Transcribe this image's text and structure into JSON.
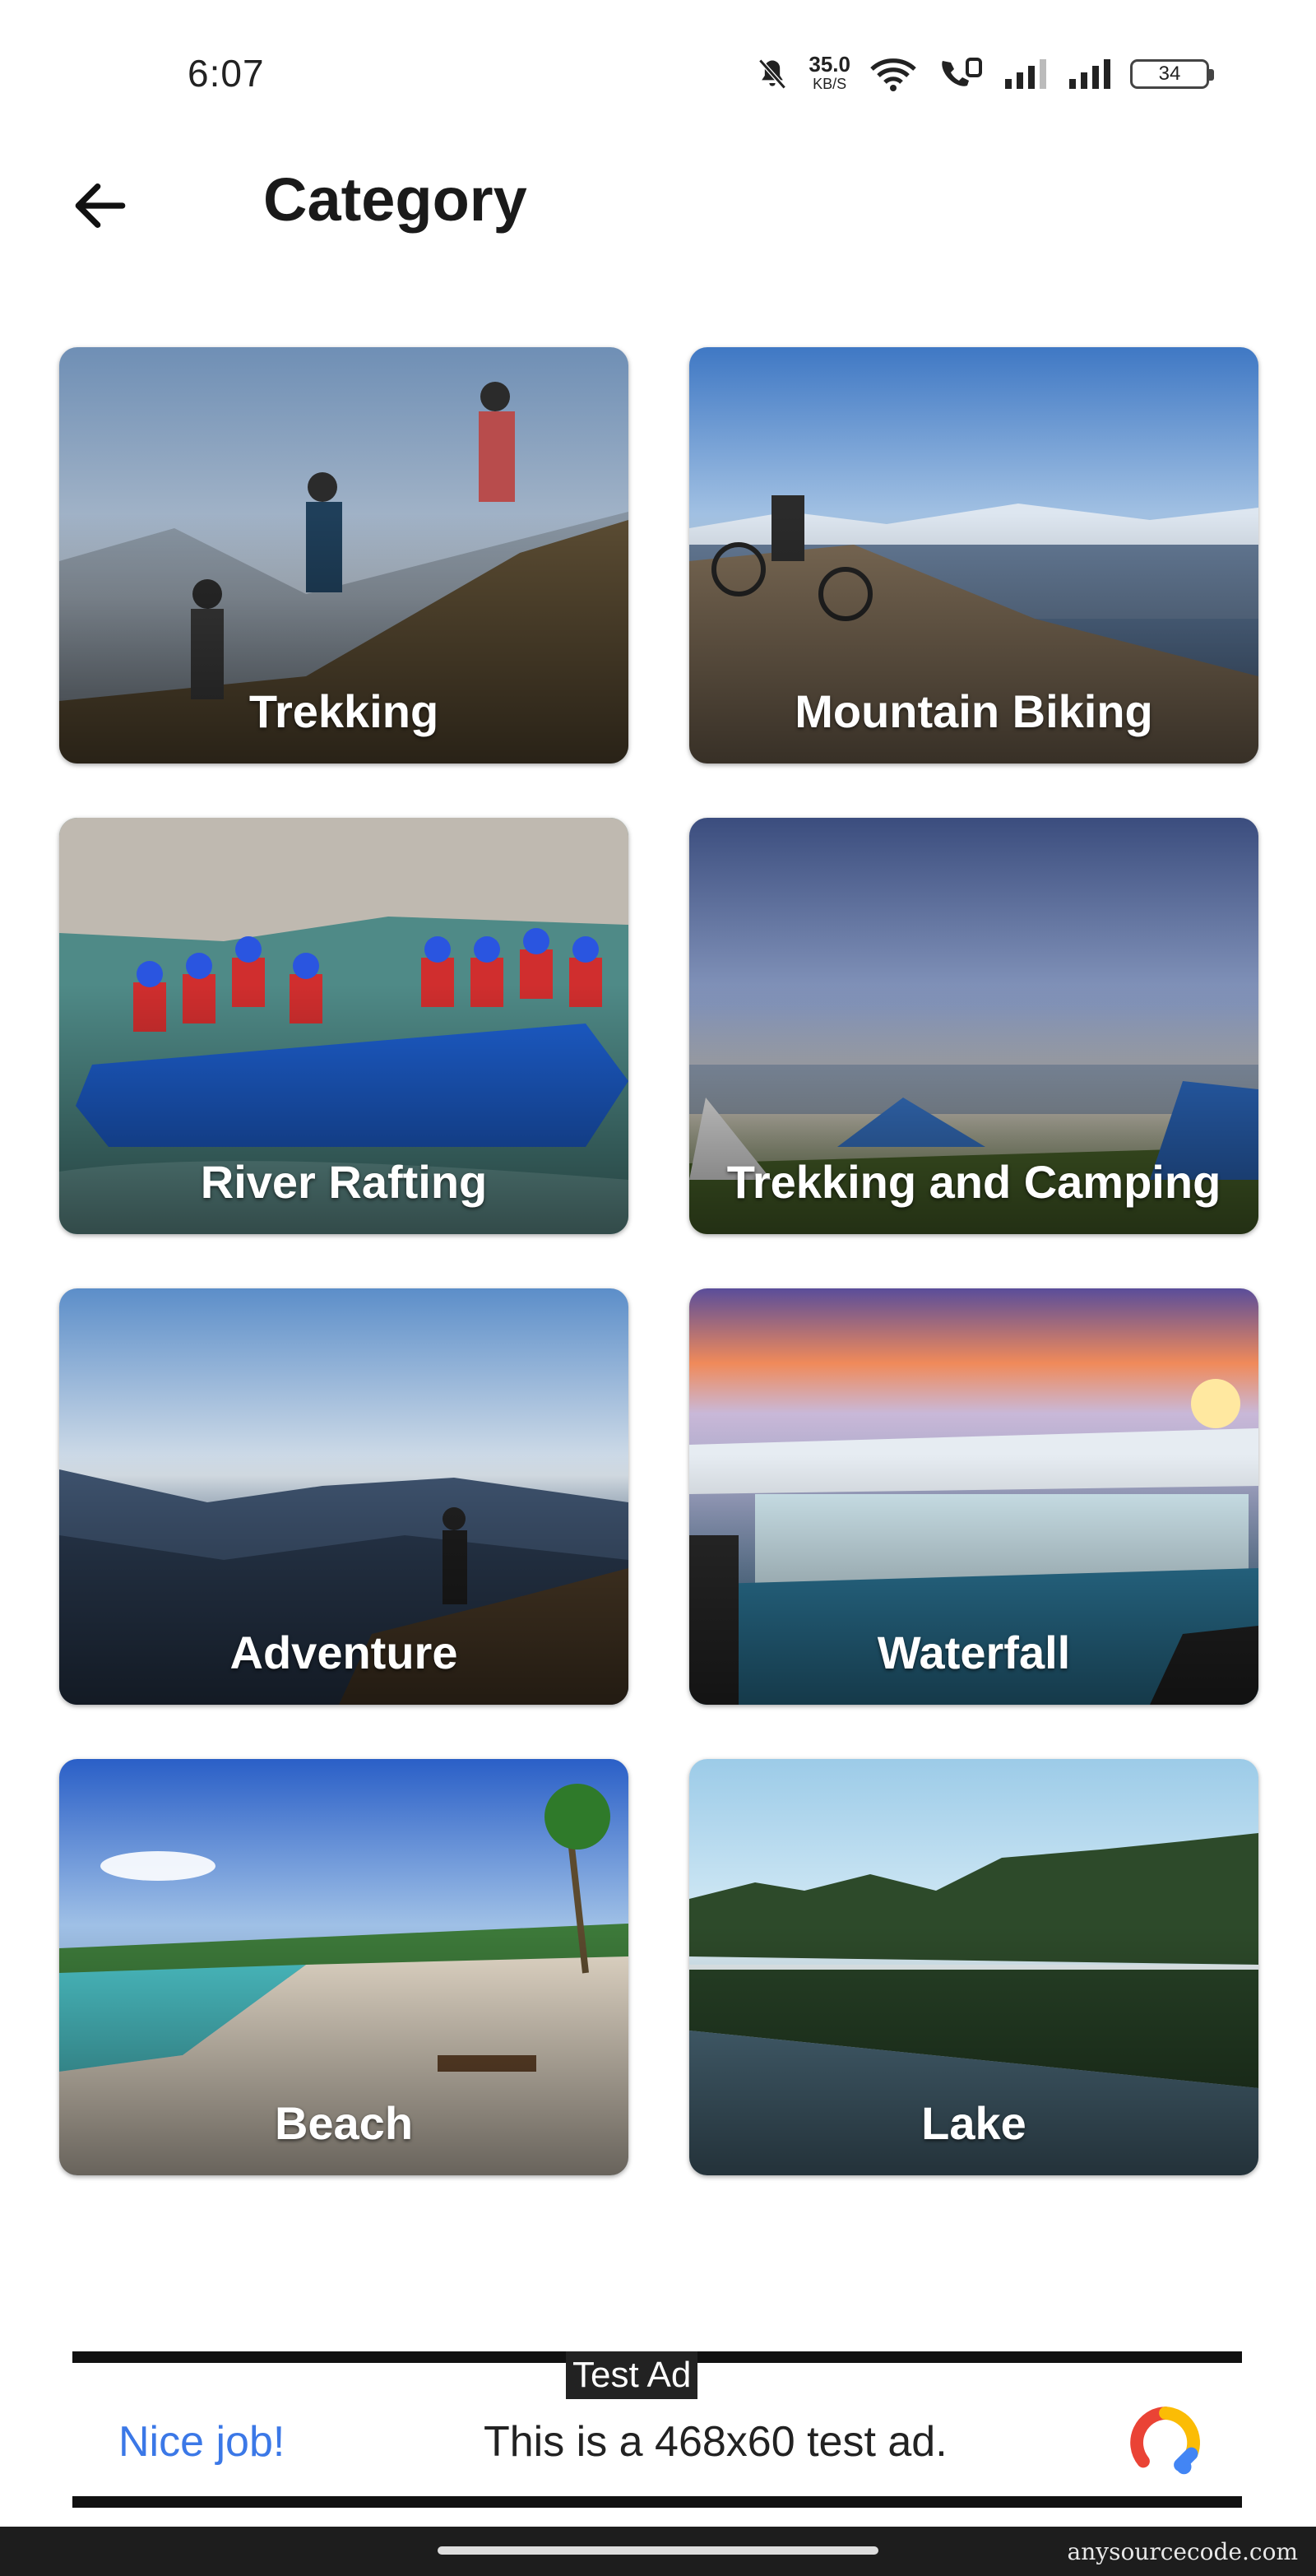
{
  "status_bar": {
    "time": "6:07",
    "net_speed": "35.0",
    "net_unit": "KB/S",
    "battery": "34"
  },
  "header": {
    "title": "Category",
    "back_icon": "arrow-left-icon"
  },
  "categories": [
    {
      "label": "Trekking"
    },
    {
      "label": "Mountain Biking"
    },
    {
      "label": "River Rafting"
    },
    {
      "label": "Trekking and Camping"
    },
    {
      "label": "Adventure"
    },
    {
      "label": "Waterfall"
    },
    {
      "label": "Beach"
    },
    {
      "label": "Lake"
    }
  ],
  "ad": {
    "tag": "Test Ad",
    "headline": "Nice job!",
    "body": "This is a 468x60 test ad."
  },
  "watermark": "anysourcecode.com"
}
